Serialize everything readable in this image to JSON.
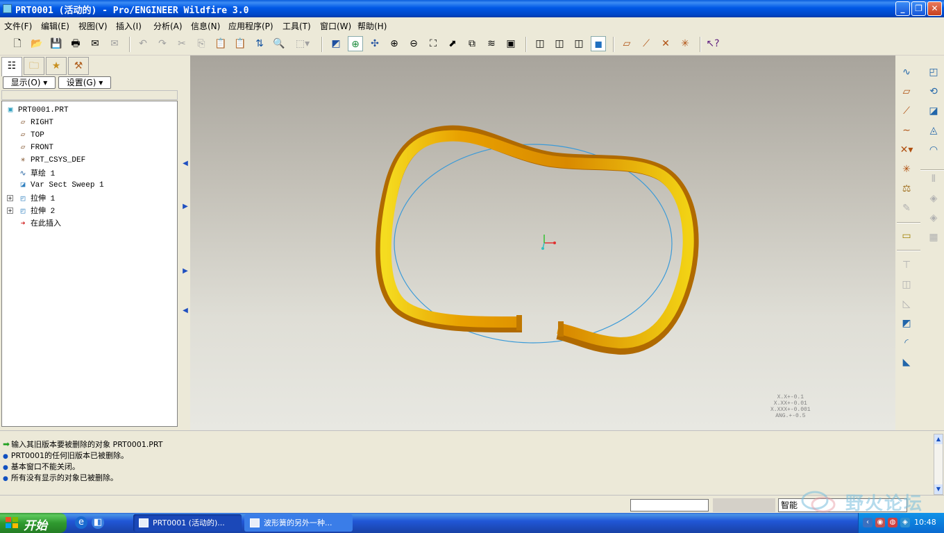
{
  "window": {
    "title": "PRT0001 (活动的) - Pro/ENGINEER Wildfire 3.0",
    "controls": [
      "minimize",
      "maximize",
      "close"
    ]
  },
  "menu": [
    "文件(F)",
    "编辑(E)",
    "视图(V)",
    "插入(I)",
    "分析(A)",
    "信息(N)",
    "应用程序(P)",
    "工具(T)",
    "窗口(W)",
    "帮助(H)"
  ],
  "toolbar": {
    "icons": [
      "new-icon",
      "open-icon",
      "save-icon",
      "print-icon",
      "email-icon",
      "email-link-icon",
      "undo-icon",
      "redo-icon",
      "cut-icon",
      "copy-icon",
      "paste-icon",
      "paste-special-icon",
      "regenerate-icon",
      "find-icon",
      "selection-box-icon",
      "repaint-icon",
      "spin-center-icon",
      "orient-mode-icon",
      "zoom-in-icon",
      "zoom-out-icon",
      "refit-icon",
      "reorient-icon",
      "saved-views-icon",
      "layers-icon",
      "view-manager-icon",
      "wireframe-icon",
      "hidden-line-icon",
      "no-hidden-icon",
      "shading-icon",
      "datum-planes-icon",
      "datum-axes-icon",
      "datum-points-icon",
      "coordinate-systems-icon",
      "context-help-icon"
    ]
  },
  "panel": {
    "tabs": [
      "model-tree-tab",
      "folder-browser-tab",
      "favorites-tab",
      "connections-tab"
    ],
    "show_label": "显示(O)",
    "settings_label": "设置(G)"
  },
  "tree": {
    "nodes": [
      {
        "label": "PRT0001.PRT",
        "icon": "part-icon"
      },
      {
        "label": "RIGHT",
        "icon": "datum-plane-icon"
      },
      {
        "label": "TOP",
        "icon": "datum-plane-icon"
      },
      {
        "label": "FRONT",
        "icon": "datum-plane-icon"
      },
      {
        "label": "PRT_CSYS_DEF",
        "icon": "csys-icon"
      },
      {
        "label": "草绘 1",
        "icon": "sketch-icon"
      },
      {
        "label": "Var Sect Sweep 1",
        "icon": "sweep-icon"
      },
      {
        "label": "拉伸 1",
        "icon": "extrude-icon",
        "expandable": true
      },
      {
        "label": "拉伸 2",
        "icon": "extrude-icon",
        "expandable": true
      },
      {
        "label": "在此插入",
        "icon": "insert-here-arrow-icon"
      }
    ]
  },
  "viewport": {
    "spring_color": "#e8a000",
    "trajectory_color": "#3a9ad8",
    "tolerance_lines": [
      "X.X+-0.1",
      "X.XX+-0.01",
      "X.XXX+-0.001",
      "ANG.+-0.5"
    ]
  },
  "right_toolbar": {
    "icons": [
      "datum-curve-sketch-icon",
      "plane-icon",
      "axis-icon",
      "curve-icon",
      "point-icon",
      "csys-tool-icon",
      "analysis-icon",
      "datum-tool-icon",
      "annotation-icon",
      "extrude-tool-icon",
      "revolve-tool-icon",
      "sweep-blend-tool-icon",
      "boundary-blend-tool-icon",
      "style-icon",
      "mirror-icon",
      "merge-icon",
      "trim-icon",
      "pattern-icon",
      "hole-icon",
      "shell-icon",
      "draft-icon",
      "rib-icon",
      "round-icon",
      "chamfer-icon"
    ]
  },
  "messages": [
    {
      "type": "prompt",
      "text": "输入其旧版本要被删除的对象    PRT0001.PRT"
    },
    {
      "type": "info",
      "text": "PRT0001的任何旧版本已被删除。"
    },
    {
      "type": "info",
      "text": "基本窗口不能关闭。"
    },
    {
      "type": "info",
      "text": "所有没有显示的对象已被删除。"
    }
  ],
  "status": {
    "filter": "智能"
  },
  "watermark": {
    "text": "野火论坛"
  },
  "taskbar": {
    "start_label": "开始",
    "tasks": [
      {
        "label": "PRT0001 (活动的)...",
        "active": true
      },
      {
        "label": "波形簧的另外一种...",
        "active": false
      }
    ],
    "clock": "10:48"
  }
}
